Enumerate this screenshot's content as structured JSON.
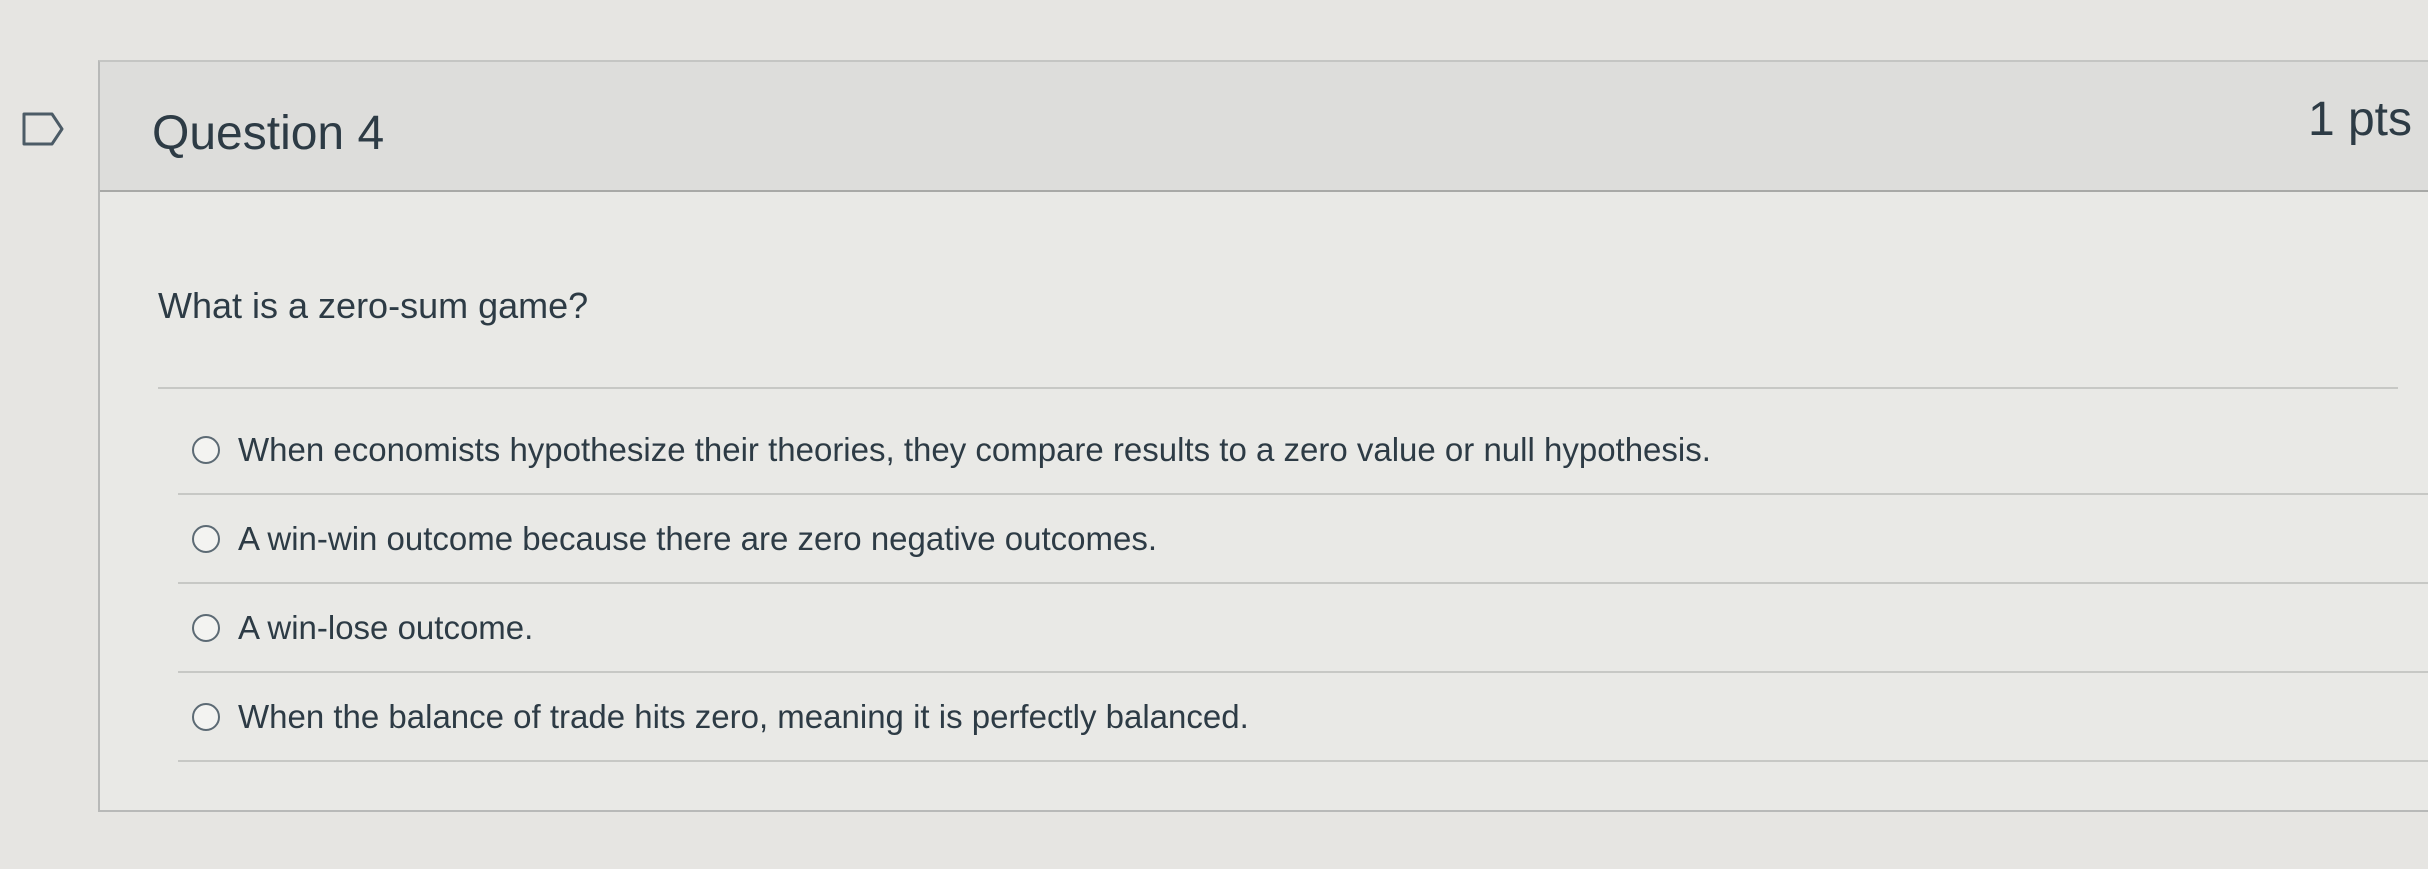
{
  "question": {
    "title": "Question 4",
    "points": "1 pts",
    "text": "What is a zero-sum game?",
    "answers": [
      {
        "label": "When economists hypothesize their theories, they compare results to a zero value or null hypothesis."
      },
      {
        "label": "A win-win outcome because there are zero negative outcomes."
      },
      {
        "label": "A win-lose outcome."
      },
      {
        "label": "When the balance of trade hits zero, meaning it is perfectly balanced."
      }
    ]
  },
  "icons": {
    "bookmark": "bookmark-flag-icon",
    "radio": "radio-unchecked-icon"
  },
  "colors": {
    "text": "#2d3b45",
    "header_background": "#dddddb",
    "card_background": "#e9e9e6",
    "border": "#b8b9b8"
  }
}
